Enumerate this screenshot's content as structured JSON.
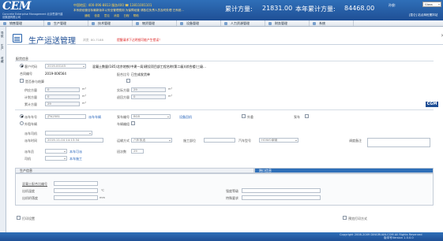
{
  "header": {
    "logo": "CEM",
    "logo_sub": "Concrete Enterprise Management 北京思源兴建设集团有限公司",
    "hotline": "中国地区: 400-096-8813 服务400 ☎ 13811001101",
    "notice": "本系统经营目标最新版本以安全管理费用 为保障经营 请各位负责人员及时处理 已系统...",
    "links": [
      "通知",
      "信息",
      "意见",
      "消息",
      "日程",
      "帮助"
    ],
    "ytd_label": "累计方量:",
    "ytd_value": "21831.00",
    "year_label": "本年累计方量:",
    "year_value": "84468.00",
    "user_label": "孙俊:",
    "role_value": "Glass",
    "location": "[昆仑] 站点商砼搅拌站"
  },
  "nav": [
    "销售管理",
    "生产管理",
    "技术管理",
    "物资管理",
    "设备管理",
    "人力资源管理",
    "财务管理",
    "系统"
  ],
  "sidebar": [
    "导航",
    "生产",
    "收藏"
  ],
  "page": {
    "title": "生产运送管理",
    "sub": "浏览",
    "number": "80-7188",
    "warning": "提醒请求下达明细可能产生错误！",
    "close": "✕"
  },
  "form": {
    "section_label": "配货信息",
    "labels": {
      "customer_code": "客户代码",
      "contract_code": "合同编号",
      "mix_ratio": "配合比号",
      "supply_qty": "供应方量",
      "planned_qty": "计划方量",
      "cumulative_qty": "累计方量",
      "volume_qty": "实际方量",
      "returned_qty": "退回方量",
      "vehicle_no": "派车车号",
      "external_vehicle": "外租车辆",
      "weigh_no": "派车司机",
      "pump_no": "泵车编号",
      "station": "搅拌站",
      "mixer": "车辆编组",
      "dispatch_time": "派车时间",
      "transport": "运输方式",
      "construction": "施工部位",
      "pump_type": "泵车",
      "vehicle_type": "汽车型号",
      "dispatch_note": "调度备注",
      "dispatcher": "派车员",
      "driver": "司机",
      "trip_count": "班次数",
      "pour_method": "浇筑方式"
    },
    "values": {
      "customer_code": "2019-00145",
      "project": "混凝土数量(185)北京地铁(中建一局)建设项目部工程名称(第二级)(综合楼)三级...",
      "contract_code": "2019-006564",
      "status": "已生成发货单",
      "mix_ratio_flag": "是否参与结算",
      "supply_qty": "0",
      "planned_qty": "0",
      "cumulative_qty": "29",
      "volume_qty": "29",
      "returned_qty": "0",
      "vehicle_no": "沪A2581",
      "pump_code": "BG8",
      "pump_link": "设备回机",
      "vehicle_link": "派车车辆",
      "trip_label": "外委",
      "pump_check": "泵车",
      "dispatch_time": "2019-11-04 14:13:34",
      "transport": "汽车泵送",
      "construction": "",
      "vehicle_type": "HOWO車辆",
      "dispatcher_link": "本车可派",
      "driver_link": "本车施工",
      "trip_count": "29"
    }
  },
  "production": {
    "tabs": [
      "生产信息",
      "跨口信息"
    ],
    "fields": {
      "mix_code": "混凝土配合比编号",
      "mix_temp": "出机温度",
      "slump": "出机坍落度",
      "temp_unit": "℃",
      "slump_unit": "mm",
      "strength": "强度等级",
      "special": "特殊要求"
    }
  },
  "bottom": {
    "print_check": "打印设置",
    "print_check2": "预览打印方式",
    "watermark": "CGM"
  },
  "footer": {
    "copyright": "Copyright 2008-2009 DINGRUAN.COM All Rights Reserved",
    "version": "版本号Version 1.0.0.0"
  }
}
